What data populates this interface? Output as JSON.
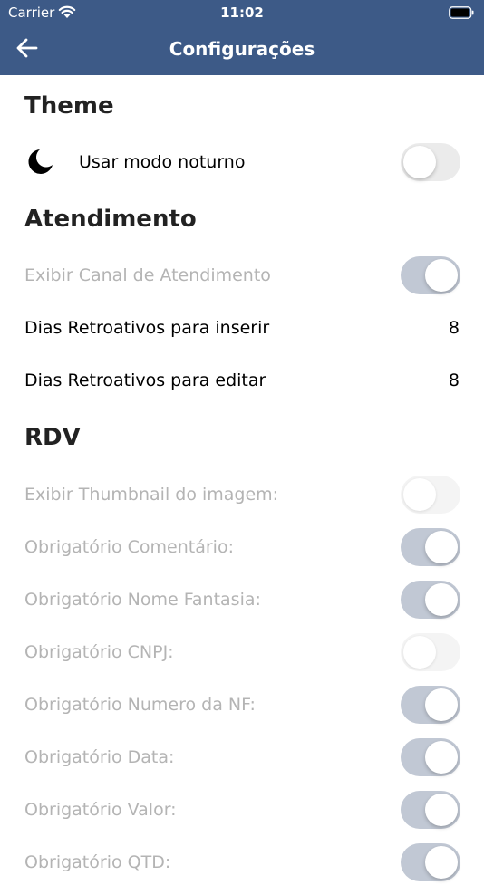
{
  "status_bar": {
    "carrier": "Carrier",
    "time": "11:02"
  },
  "header": {
    "title": "Configurações"
  },
  "theme": {
    "heading": "Theme",
    "dark_mode_label": "Usar modo noturno",
    "dark_mode_on": false
  },
  "atendimento": {
    "heading": "Atendimento",
    "exibir_canal_label": "Exibir Canal de Atendimento",
    "exibir_canal_on": true,
    "dias_inserir_label": "Dias Retroativos para inserir",
    "dias_inserir_value": "8",
    "dias_editar_label": "Dias Retroativos para editar",
    "dias_editar_value": "8"
  },
  "rdv": {
    "heading": "RDV",
    "items": [
      {
        "label": "Exibir Thumbnail do imagem:",
        "on": false
      },
      {
        "label": "Obrigatório Comentário:",
        "on": true
      },
      {
        "label": "Obrigatório Nome Fantasia:",
        "on": true
      },
      {
        "label": "Obrigatório CNPJ:",
        "on": false
      },
      {
        "label": "Obrigatório Numero da NF:",
        "on": true
      },
      {
        "label": "Obrigatório Data:",
        "on": true
      },
      {
        "label": "Obrigatório Valor:",
        "on": true
      },
      {
        "label": "Obrigatório QTD:",
        "on": true
      }
    ]
  },
  "colors": {
    "header_bg": "#3d5a87",
    "toggle_on_disabled": "#c1c8d4",
    "disabled_text": "#b4b4b4"
  },
  "icons": {
    "back": "arrow-left-icon",
    "moon": "moon-icon",
    "wifi": "wifi-icon",
    "battery": "battery-icon"
  }
}
